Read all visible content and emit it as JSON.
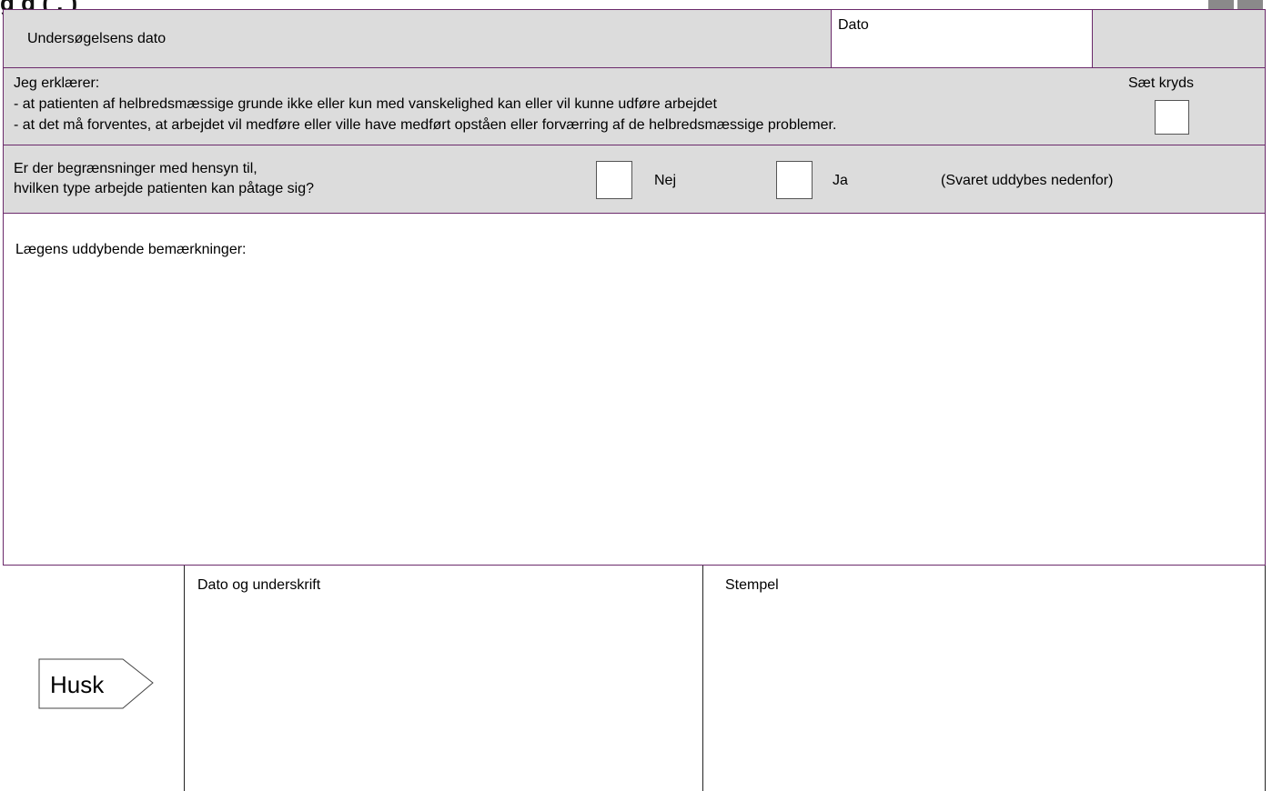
{
  "header": {
    "title_fragment": "g       g   (                                                             ,                        )"
  },
  "row1": {
    "label": "Undersøgelsens dato",
    "date_label": "Dato"
  },
  "row2": {
    "line1": "Jeg erklærer:",
    "line2": "- at patienten af helbredsmæssige grunde ikke eller kun med vanskelighed kan eller vil kunne udføre arbejdet",
    "line3": "- at det må forventes, at arbejdet vil medføre eller ville have medført opståen eller forværring af de helbredsmæssige problemer.",
    "checkbox_label": "Sæt kryds"
  },
  "row3": {
    "question_line1": "Er der begrænsninger med hensyn til,",
    "question_line2": "hvilken type arbejde patienten kan påtage sig?",
    "option_no": "Nej",
    "option_yes": "Ja",
    "note": "(Svaret uddybes nedenfor)"
  },
  "row4": {
    "label": "Lægens uddybende bemærkninger:"
  },
  "footer": {
    "reminder": "Husk",
    "signature_label": "Dato og underskrift",
    "stamp_label": "Stempel"
  }
}
